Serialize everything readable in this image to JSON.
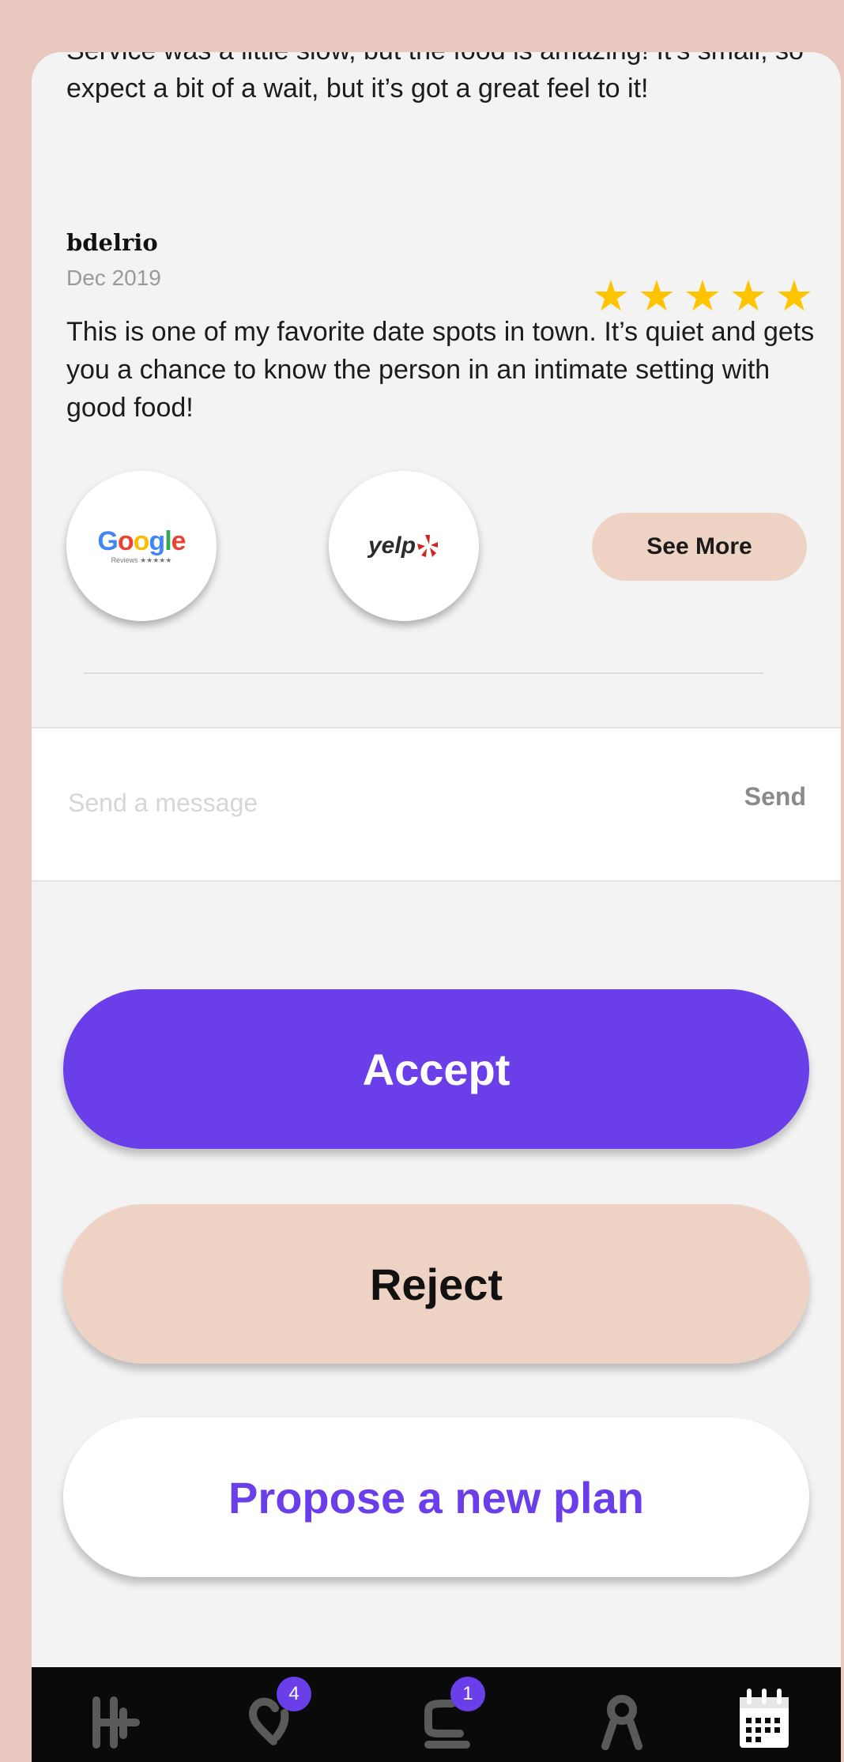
{
  "review_partial_text": "Service was a little slow, but the food is amazing! It’s small, so expect a bit of a wait, but it’s got a great feel to it!",
  "review": {
    "author": "bdelrio",
    "date": "Dec 2019",
    "rating": 5,
    "text": "This is one of my favorite date spots in town. It’s quiet and gets you a chance to know the person in an intimate setting with good food!"
  },
  "sources": {
    "google": {
      "word": "Google",
      "subtitle": "Reviews ★★★★★"
    },
    "yelp": {
      "word": "yelp"
    }
  },
  "see_more_label": "See More",
  "message": {
    "placeholder": "Send a message",
    "value": "",
    "send_label": "Send"
  },
  "actions": {
    "accept": "Accept",
    "reject": "Reject",
    "propose": "Propose a new plan"
  },
  "nav": {
    "items": [
      {
        "icon": "home-logo-icon"
      },
      {
        "icon": "heart-icon",
        "badge": "4"
      },
      {
        "icon": "chat-icon",
        "badge": "1"
      },
      {
        "icon": "profile-icon"
      },
      {
        "icon": "calendar-icon"
      }
    ]
  },
  "colors": {
    "primary": "#6a3fea",
    "accent_peach": "#eed2c4",
    "star": "#ffc400"
  }
}
